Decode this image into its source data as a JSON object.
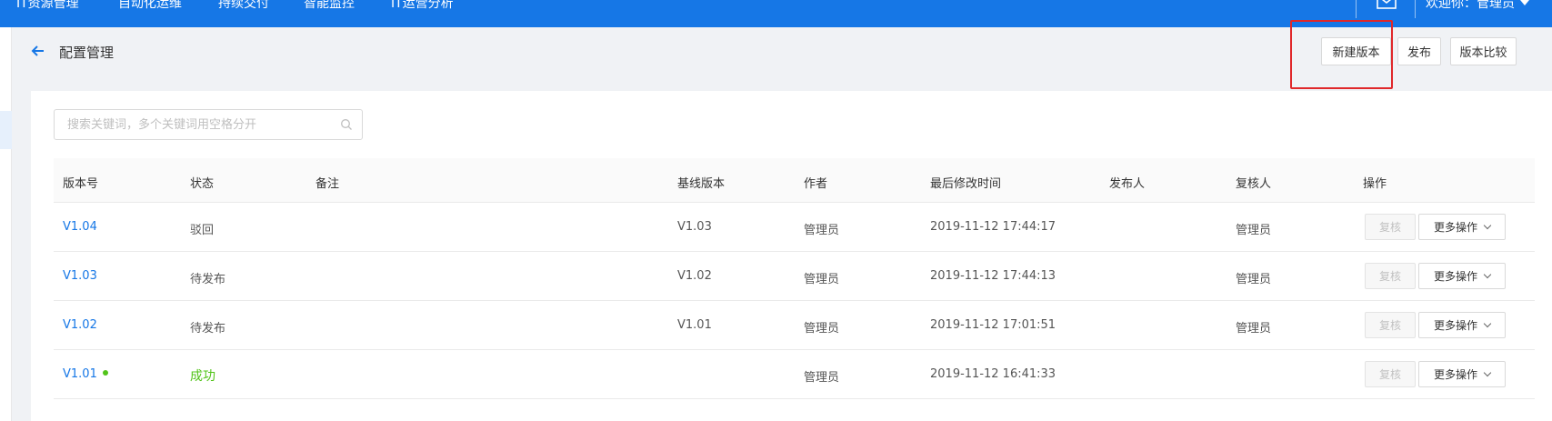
{
  "topbar": {
    "nav": [
      "IT资源管理",
      "自动化运维",
      "持续交付",
      "智能监控",
      "IT运营分析"
    ],
    "welcome": "欢迎你：管理员",
    "mail_icon": "mail-icon",
    "accent_color": "#1677e6"
  },
  "page": {
    "title": "配置管理",
    "back_icon": "arrow-left-icon"
  },
  "actions": {
    "new_version": "新建版本",
    "publish": "发布",
    "compare": "版本比较"
  },
  "search": {
    "placeholder": "搜索关键词，多个关键词用空格分开",
    "value": ""
  },
  "table": {
    "columns": [
      "版本号",
      "状态",
      "备注",
      "基线版本",
      "作者",
      "最后修改时间",
      "发布人",
      "复核人",
      "操作"
    ],
    "rows": [
      {
        "version": "V1.04",
        "status": "驳回",
        "note": "",
        "baseline": "V1.03",
        "author": "管理员",
        "modified": "2019-11-12 17:44:17",
        "publisher": "",
        "reviewer": "管理员",
        "review_btn": "复核",
        "more_btn": "更多操作"
      },
      {
        "version": "V1.03",
        "status": "待发布",
        "note": "",
        "baseline": "V1.02",
        "author": "管理员",
        "modified": "2019-11-12 17:44:13",
        "publisher": "",
        "reviewer": "管理员",
        "review_btn": "复核",
        "more_btn": "更多操作"
      },
      {
        "version": "V1.02",
        "status": "待发布",
        "note": "",
        "baseline": "V1.01",
        "author": "管理员",
        "modified": "2019-11-12 17:01:51",
        "publisher": "",
        "reviewer": "管理员",
        "review_btn": "复核",
        "more_btn": "更多操作"
      },
      {
        "version": "V1.01",
        "status": "成功",
        "note": "",
        "baseline": "",
        "author": "管理员",
        "modified": "2019-11-12 16:41:33",
        "publisher": "",
        "reviewer": "",
        "review_btn": "复核",
        "more_btn": "更多操作"
      }
    ]
  },
  "colors": {
    "success": "#52c41a",
    "highlight_box": "#e0282a"
  }
}
